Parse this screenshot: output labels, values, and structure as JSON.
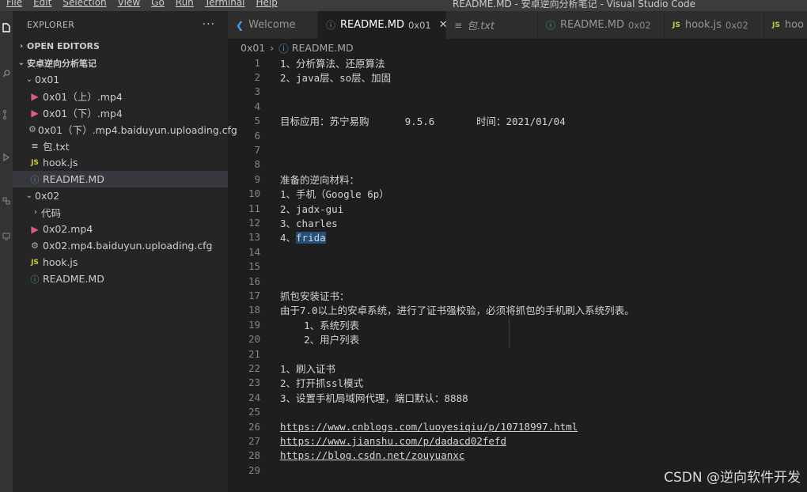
{
  "menu": [
    "File",
    "Edit",
    "Selection",
    "View",
    "Go",
    "Run",
    "Terminal",
    "Help"
  ],
  "window_title": "README.MD - 安卓逆向分析笔记 - Visual Studio Code",
  "explorer": {
    "title": "EXPLORER",
    "more": "···",
    "open_editors": "OPEN EDITORS",
    "root": "安卓逆向分析笔记",
    "items": [
      {
        "label": "0x01",
        "kind": "folder"
      },
      {
        "label": "0x01（上）.mp4",
        "kind": "video"
      },
      {
        "label": "0x01（下）.mp4",
        "kind": "video"
      },
      {
        "label": "0x01（下）.mp4.baiduyun.uploading.cfg",
        "kind": "gear"
      },
      {
        "label": "包.txt",
        "kind": "txt"
      },
      {
        "label": "hook.js",
        "kind": "js"
      },
      {
        "label": "README.MD",
        "kind": "info",
        "selected": true
      },
      {
        "label": "0x02",
        "kind": "folder"
      },
      {
        "label": "代码",
        "kind": "folder-collapsed"
      },
      {
        "label": "0x02.mp4",
        "kind": "video"
      },
      {
        "label": "0x02.mp4.baiduyun.uploading.cfg",
        "kind": "gear"
      },
      {
        "label": "hook.js",
        "kind": "js"
      },
      {
        "label": "README.MD",
        "kind": "info"
      }
    ]
  },
  "tabs": [
    {
      "label": "Welcome",
      "dim": "",
      "icon": "vscode"
    },
    {
      "label": "README.MD",
      "dim": "0x01",
      "icon": "info",
      "active": true
    },
    {
      "label": "包.txt",
      "dim": "",
      "icon": "txt",
      "italic": true
    },
    {
      "label": "README.MD",
      "dim": "0x02",
      "icon": "info"
    },
    {
      "label": "hook.js",
      "dim": "0x02",
      "icon": "js"
    },
    {
      "label": "hoo",
      "dim": "",
      "icon": "js"
    }
  ],
  "breadcrumb": {
    "folder": "0x01",
    "file": "README.MD"
  },
  "editor": {
    "lines": [
      {
        "n": "1",
        "text": "1、分析算法、还原算法"
      },
      {
        "n": "2",
        "text": "2、java层、so层、加固"
      },
      {
        "n": "3",
        "text": ""
      },
      {
        "n": "4",
        "text": ""
      },
      {
        "n": "5",
        "text": "目标应用：苏宁易购      9.5.6       时间：2021/01/04"
      },
      {
        "n": "6",
        "text": ""
      },
      {
        "n": "7",
        "text": ""
      },
      {
        "n": "8",
        "text": ""
      },
      {
        "n": "9",
        "text": "准备的逆向材料："
      },
      {
        "n": "10",
        "text": "1、手机（Google 6p）"
      },
      {
        "n": "11",
        "text": "2、jadx-gui"
      },
      {
        "n": "12",
        "text": "3、charles"
      },
      {
        "n": "13",
        "prefix": "4、",
        "highlight": "frida"
      },
      {
        "n": "14",
        "text": ""
      },
      {
        "n": "15",
        "text": ""
      },
      {
        "n": "16",
        "text": ""
      },
      {
        "n": "17",
        "text": "抓包安装证书："
      },
      {
        "n": "18",
        "text": "由于7.0以上的安卓系统，进行了证书强校验，必须将抓包的手机刷入系统列表。"
      },
      {
        "n": "19",
        "text": "    1、系统列表"
      },
      {
        "n": "20",
        "text": "    2、用户列表"
      },
      {
        "n": "21",
        "text": ""
      },
      {
        "n": "22",
        "text": "1、刷入证书"
      },
      {
        "n": "23",
        "text": "2、打开抓ssl模式"
      },
      {
        "n": "24",
        "text": "3、设置手机局域网代理，端口默认：8888"
      },
      {
        "n": "25",
        "text": ""
      },
      {
        "n": "26",
        "link": "https://www.cnblogs.com/luoyesiqiu/p/10718997.html"
      },
      {
        "n": "27",
        "link": "https://www.jianshu.com/p/dadacd02fefd"
      },
      {
        "n": "28",
        "link": "https://blog.csdn.net/zouyuanxc"
      },
      {
        "n": "29",
        "text": ""
      }
    ]
  },
  "watermark": "CSDN @逆向软件开发"
}
